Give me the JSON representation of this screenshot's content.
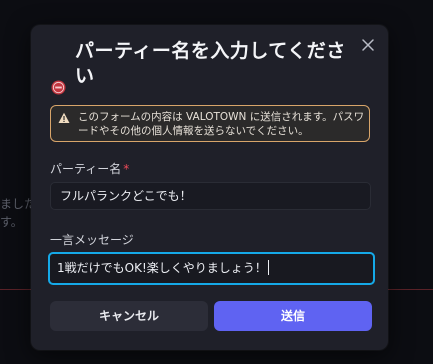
{
  "background": {
    "text_lines": [
      "ました",
      "す。"
    ]
  },
  "dialog": {
    "title": "パーティー名を入力してください",
    "notice": {
      "icon": "warning-icon",
      "text": "このフォームの内容は VALOTOWN に送信されます。パスワードやその他の個人情報を送らないでください。"
    },
    "party_name": {
      "label": "パーティー名",
      "required_mark": "*",
      "value": "フルパランクどこでも！"
    },
    "message": {
      "label": "一言メッセージ",
      "value": "1戦だけでもOK!楽しくやりましょう！"
    },
    "cancel_label": "キャンセル",
    "send_label": "送信"
  },
  "colors": {
    "dialog_bg": "#1f2029",
    "accent": "#5f63f2",
    "focus_border": "#15a9e8",
    "warning_border": "#d8a56a",
    "required": "#ef4b5a"
  }
}
